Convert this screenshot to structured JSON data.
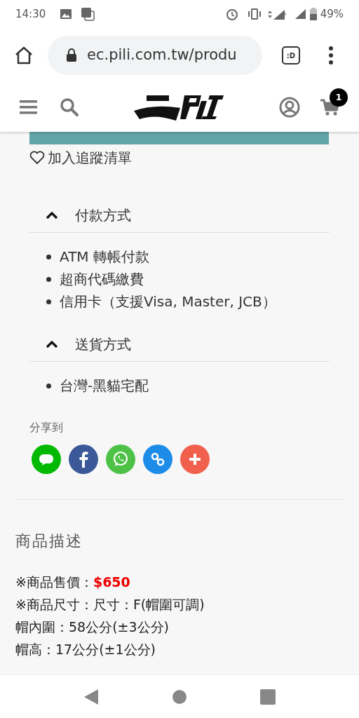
{
  "status_bar": {
    "time": "14:30",
    "battery": "49%"
  },
  "browser": {
    "url": "ec.pili.com.tw/produ",
    "tab_icon": ":D"
  },
  "header": {
    "cart_count": "1"
  },
  "wishlist": {
    "label": "加入追蹤清單"
  },
  "sections": [
    {
      "title": "付款方式",
      "expanded": true,
      "items": [
        "ATM 轉帳付款",
        "超商代碼繳費",
        "信用卡（支援Visa, Master, JCB）"
      ]
    },
    {
      "title": "送貨方式",
      "expanded": true,
      "items": [
        "台灣-黑貓宅配"
      ]
    }
  ],
  "share": {
    "label": "分享到",
    "buttons": [
      {
        "kind": "line",
        "color": "#00b900"
      },
      {
        "kind": "facebook",
        "color": "#3b5998"
      },
      {
        "kind": "whatsapp",
        "color": "#4dc247"
      },
      {
        "kind": "link",
        "color": "#1d8ce8"
      },
      {
        "kind": "more",
        "color": "#f0604d"
      }
    ]
  },
  "description": {
    "title": "商品描述",
    "lines": [
      {
        "label": "※商品售價：",
        "price": "$650"
      },
      {
        "label": "※商品尺寸：尺寸：F(帽圍可調)"
      },
      {
        "label": "帽內圍：58公分(±3公分)"
      },
      {
        "label": "帽高：17公分(±1公分)"
      }
    ]
  }
}
